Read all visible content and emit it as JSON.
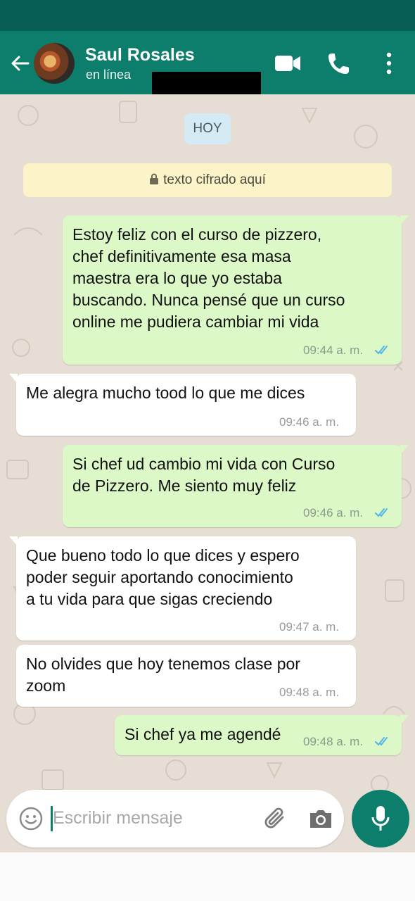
{
  "header": {
    "contact_name": "Saul Rosales",
    "presence": "en línea",
    "icons": [
      "back-arrow-icon",
      "avatar",
      "video-call-icon",
      "phone-icon",
      "more-vert-icon"
    ]
  },
  "chat": {
    "date_chip": "HOY",
    "encryption_notice": "texto cifrado aquí",
    "messages": [
      {
        "direction": "outgoing",
        "text": "Estoy feliz con el curso de pizzero,\nchef definitivamente esa masa\nmaestra era lo que yo estaba\nbuscando. Nunca pensé que un curso\nonline me pudiera cambiar mi vida",
        "time": "09:44 a. m.",
        "status": "read"
      },
      {
        "direction": "incoming",
        "text": "Me alegra mucho tood lo que me dices",
        "time": "09:46 a. m."
      },
      {
        "direction": "outgoing",
        "text": "Si chef ud cambio mi vida con Curso\nde Pizzero. Me siento muy feliz",
        "time": "09:46 a. m.",
        "status": "read"
      },
      {
        "direction": "incoming",
        "text": "Que bueno todo lo que dices y espero\npoder seguir aportando conocimiento\na tu vida para que sigas creciendo",
        "time": "09:47 a. m."
      },
      {
        "direction": "incoming",
        "text": "No olvides que hoy tenemos clase por\nzoom",
        "time": "09:48 a. m."
      },
      {
        "direction": "outgoing",
        "text": "Si chef ya me agendé",
        "time": "09:48 a. m.",
        "status": "read"
      }
    ]
  },
  "composer": {
    "placeholder": "Escribir mensaje"
  },
  "colors": {
    "statusbar": "#075e54",
    "header": "#0d7d6c",
    "outgoing_bubble": "#dcf8c6",
    "incoming_bubble": "#ffffff",
    "read_ticks": "#4fb6ec",
    "chat_background": "#e6ddd4"
  }
}
